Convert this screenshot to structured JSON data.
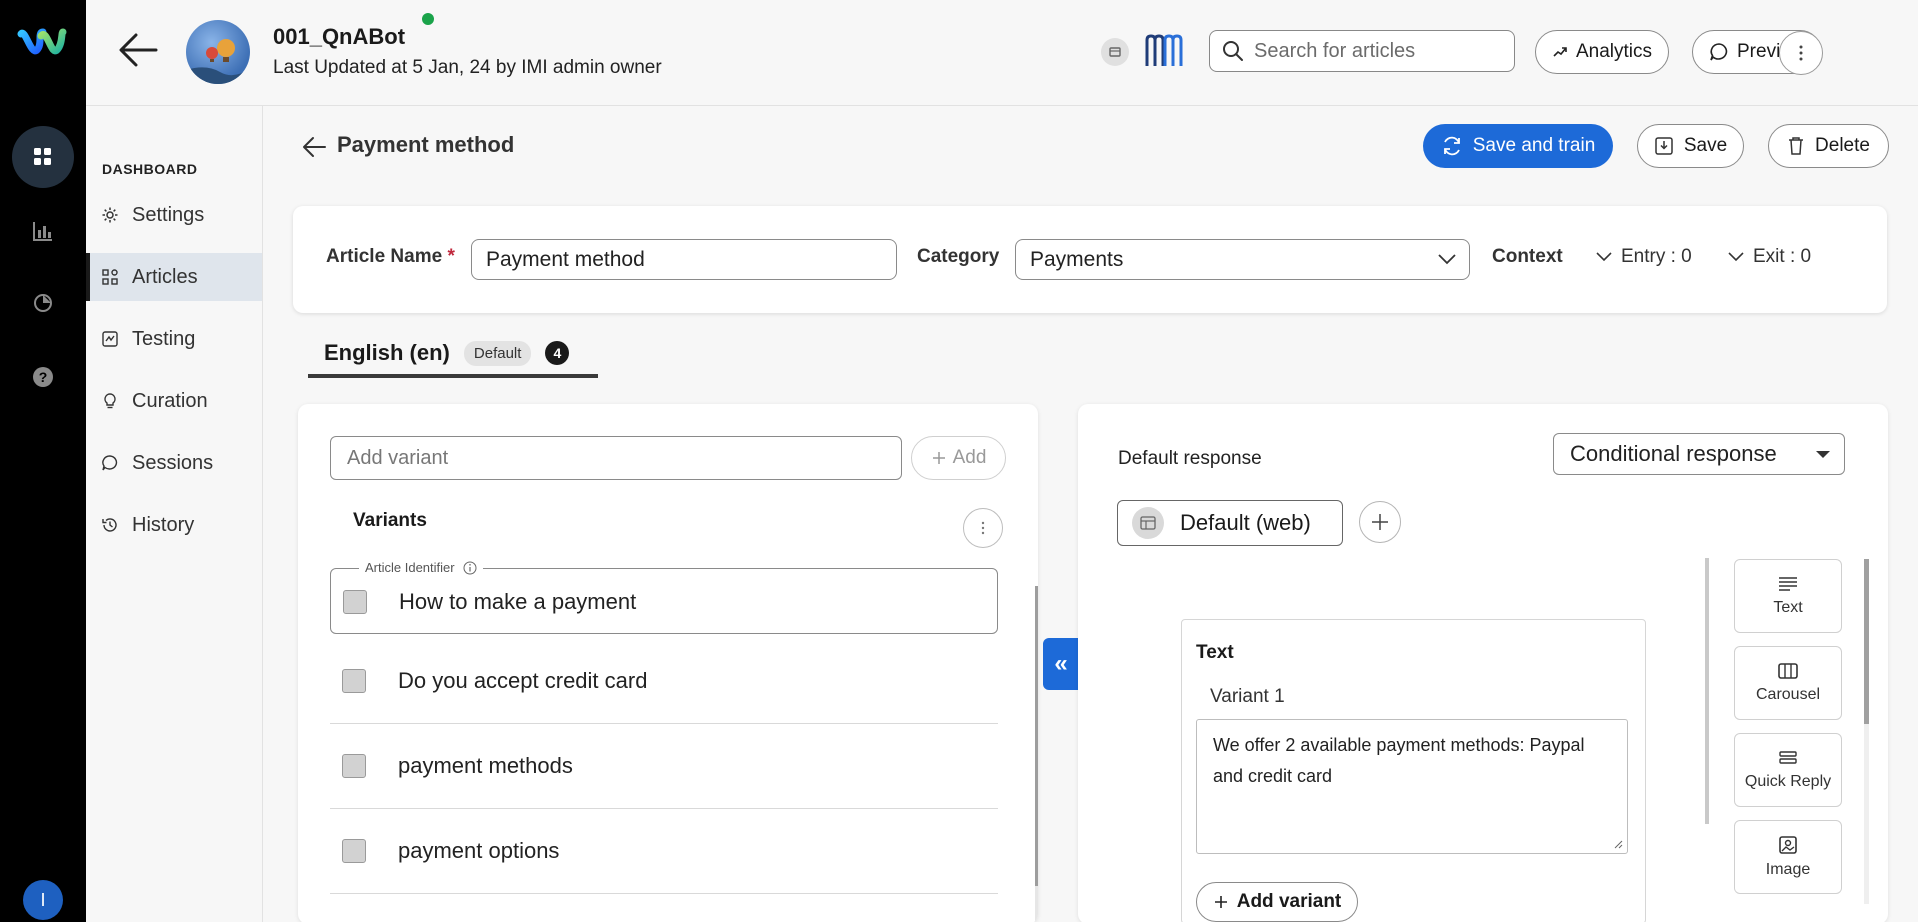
{
  "header": {
    "bot_name": "001_QnABot",
    "last_updated": "Last Updated at 5 Jan, 24 by IMI admin owner",
    "search_placeholder": "Search for articles",
    "analytics_label": "Analytics",
    "preview_label": "Preview"
  },
  "rail": {
    "user_initial": "I",
    "items": [
      "grid-icon",
      "bar-chart-icon",
      "pie-chart-icon",
      "help-icon"
    ]
  },
  "sidebar": {
    "section": "DASHBOARD",
    "items": [
      {
        "label": "Settings",
        "icon": "gear-icon"
      },
      {
        "label": "Articles",
        "icon": "articles-icon",
        "active": true
      },
      {
        "label": "Testing",
        "icon": "testing-icon"
      },
      {
        "label": "Curation",
        "icon": "bulb-icon"
      },
      {
        "label": "Sessions",
        "icon": "chat-icon"
      },
      {
        "label": "History",
        "icon": "history-icon"
      }
    ]
  },
  "page": {
    "title": "Payment method",
    "save_train_label": "Save and train",
    "save_label": "Save",
    "delete_label": "Delete"
  },
  "meta": {
    "article_name_label": "Article Name",
    "required_mark": "*",
    "article_name_value": "Payment method",
    "category_label": "Category",
    "category_value": "Payments",
    "context_label": "Context",
    "entry_label": "Entry : 0",
    "exit_label": "Exit : 0"
  },
  "language_tab": {
    "name": "English (en)",
    "badge": "Default",
    "count": "4"
  },
  "variants": {
    "input_placeholder": "Add variant",
    "add_label": "Add",
    "title": "Variants",
    "identifier_legend": "Article Identifier",
    "identifier": "How to make a payment",
    "items": [
      "Do you accept credit card",
      "payment methods",
      "payment options"
    ]
  },
  "response": {
    "default_label": "Default response",
    "mode": "Conditional response",
    "channel": "Default (web)",
    "card_title": "Text",
    "variant_label": "Variant 1",
    "text": "We offer 2 available payment methods: Paypal and credit card",
    "add_variant_label": "Add variant",
    "tools": [
      "Text",
      "Carousel",
      "Quick Reply",
      "Image"
    ]
  },
  "colors": {
    "primary": "#1d6ad8",
    "online": "#1aa34a",
    "rail_bg": "#000000"
  }
}
